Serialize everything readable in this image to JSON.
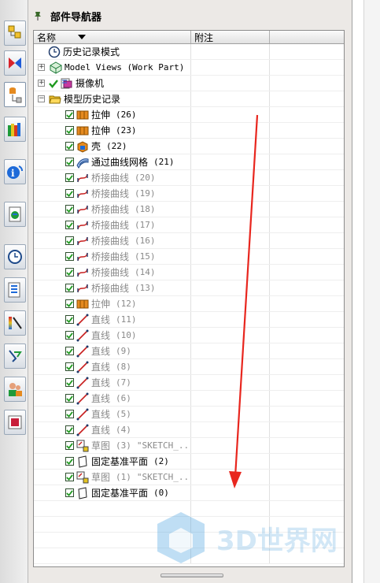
{
  "panel": {
    "title": "部件导航器"
  },
  "columns": {
    "name": "名称",
    "note": "附注"
  },
  "tree": {
    "history_mode": "历史记录模式",
    "model_views": "Model Views (Work Part)",
    "camera": "摄像机",
    "model_history": "模型历史记录",
    "features": [
      {
        "label": "拉伸",
        "num": "(26)",
        "icon": "extrude-icon",
        "gray": false,
        "extra": ""
      },
      {
        "label": "拉伸",
        "num": "(23)",
        "icon": "extrude-icon",
        "gray": false,
        "extra": ""
      },
      {
        "label": "壳",
        "num": "(22)",
        "icon": "shell-icon",
        "gray": false,
        "extra": ""
      },
      {
        "label": "通过曲线网格",
        "num": "(21)",
        "icon": "mesh-surface-icon",
        "gray": false,
        "extra": ""
      },
      {
        "label": "桥接曲线",
        "num": "(20)",
        "icon": "bridge-curve-icon",
        "gray": true,
        "extra": ""
      },
      {
        "label": "桥接曲线",
        "num": "(19)",
        "icon": "bridge-curve-icon",
        "gray": true,
        "extra": ""
      },
      {
        "label": "桥接曲线",
        "num": "(18)",
        "icon": "bridge-curve-icon",
        "gray": true,
        "extra": ""
      },
      {
        "label": "桥接曲线",
        "num": "(17)",
        "icon": "bridge-curve-icon",
        "gray": true,
        "extra": ""
      },
      {
        "label": "桥接曲线",
        "num": "(16)",
        "icon": "bridge-curve-icon",
        "gray": true,
        "extra": ""
      },
      {
        "label": "桥接曲线",
        "num": "(15)",
        "icon": "bridge-curve-icon",
        "gray": true,
        "extra": ""
      },
      {
        "label": "桥接曲线",
        "num": "(14)",
        "icon": "bridge-curve-icon",
        "gray": true,
        "extra": ""
      },
      {
        "label": "桥接曲线",
        "num": "(13)",
        "icon": "bridge-curve-icon",
        "gray": true,
        "extra": ""
      },
      {
        "label": "拉伸",
        "num": "(12)",
        "icon": "extrude-icon",
        "gray": true,
        "extra": ""
      },
      {
        "label": "直线",
        "num": "(11)",
        "icon": "line-icon",
        "gray": true,
        "extra": ""
      },
      {
        "label": "直线",
        "num": "(10)",
        "icon": "line-icon",
        "gray": true,
        "extra": ""
      },
      {
        "label": "直线",
        "num": "(9)",
        "icon": "line-icon",
        "gray": true,
        "extra": ""
      },
      {
        "label": "直线",
        "num": "(8)",
        "icon": "line-icon",
        "gray": true,
        "extra": ""
      },
      {
        "label": "直线",
        "num": "(7)",
        "icon": "line-icon",
        "gray": true,
        "extra": ""
      },
      {
        "label": "直线",
        "num": "(6)",
        "icon": "line-icon",
        "gray": true,
        "extra": ""
      },
      {
        "label": "直线",
        "num": "(5)",
        "icon": "line-icon",
        "gray": true,
        "extra": ""
      },
      {
        "label": "直线",
        "num": "(4)",
        "icon": "line-icon",
        "gray": true,
        "extra": ""
      },
      {
        "label": "草图",
        "num": "(3)",
        "icon": "sketch-icon",
        "gray": true,
        "extra": "\"SKETCH_..."
      },
      {
        "label": "固定基准平面",
        "num": "(2)",
        "icon": "datum-plane-icon",
        "gray": false,
        "extra": ""
      },
      {
        "label": "草图",
        "num": "(1)",
        "icon": "sketch-icon",
        "gray": true,
        "extra": "\"SKETCH_..."
      },
      {
        "label": "固定基准平面",
        "num": "(0)",
        "icon": "datum-plane-icon",
        "gray": false,
        "extra": ""
      }
    ]
  },
  "watermark": {
    "text": "3D世界网"
  },
  "colors": {
    "check_green": "#1f9a1f",
    "arrow_red": "#e8261e",
    "extrude_orange": "#e58a1f",
    "line_red": "#c81e1e"
  }
}
